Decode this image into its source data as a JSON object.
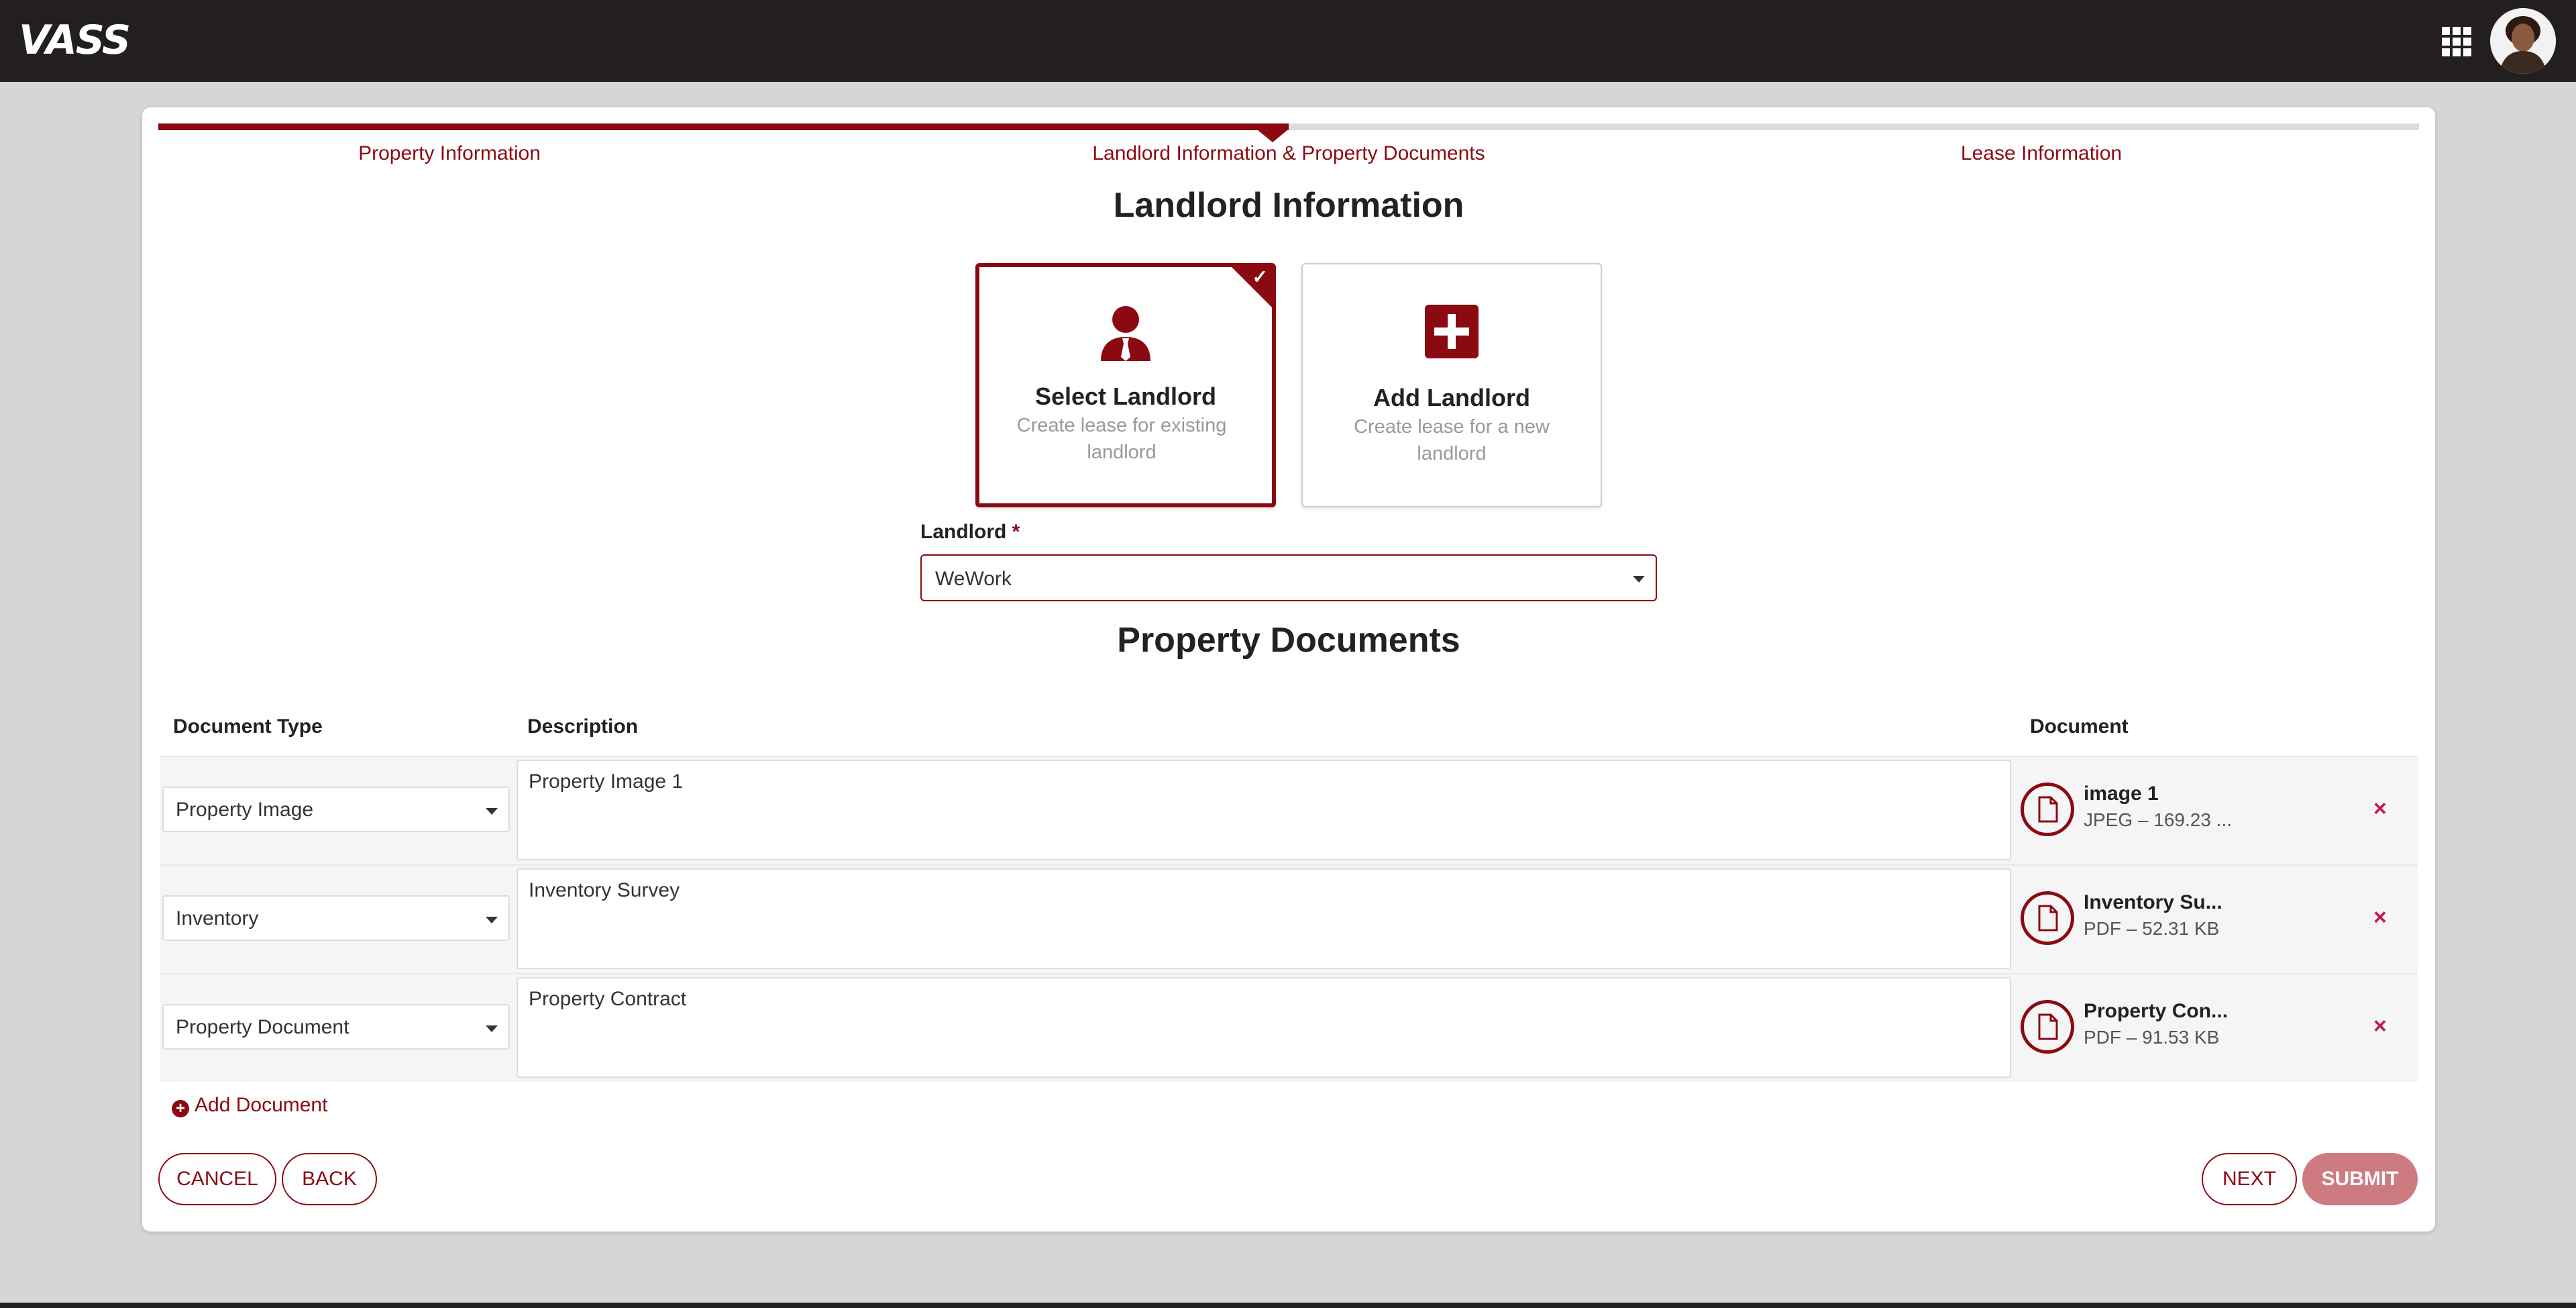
{
  "header": {
    "logo_text": "VASS",
    "apps_icon": "grid-apps-icon",
    "avatar_icon": "user-avatar"
  },
  "stepper": {
    "steps": [
      {
        "label": "Property Information"
      },
      {
        "label": "Landlord Information & Property Documents"
      },
      {
        "label": "Lease Information"
      }
    ],
    "current_step": 2,
    "progress_fraction": 0.5
  },
  "landlord": {
    "heading": "Landlord Information",
    "options": [
      {
        "title": "Select Landlord",
        "subtitle": "Create lease for existing landlord",
        "icon": "person-tie-icon",
        "selected": true
      },
      {
        "title": "Add Landlord",
        "subtitle": "Create lease for a new landlord",
        "icon": "plus-square-icon",
        "selected": false
      }
    ],
    "field_label": "Landlord",
    "required_mark": "*",
    "selected_value": "WeWork"
  },
  "documents": {
    "heading": "Property Documents",
    "columns": [
      "Document Type",
      "Description",
      "Document"
    ],
    "rows": [
      {
        "type": "Property Image",
        "description": "Property Image 1",
        "file_name": "image 1",
        "file_meta": "JPEG – 169.23 ..."
      },
      {
        "type": "Inventory",
        "description": "Inventory Survey",
        "file_name": "Inventory Su...",
        "file_meta": "PDF – 52.31 KB"
      },
      {
        "type": "Property Document",
        "description": "Property Contract",
        "file_name": "Property Con...",
        "file_meta": "PDF – 91.53 KB"
      }
    ],
    "remove_glyph": "×",
    "add_label": "Add Document"
  },
  "actions": {
    "cancel": "CANCEL",
    "back": "BACK",
    "next": "NEXT",
    "submit": "SUBMIT"
  },
  "colors": {
    "brand": "#8b0a12",
    "topbar": "#231f20",
    "remove": "#c2185b",
    "submit_disabled": "#cd7b80"
  }
}
